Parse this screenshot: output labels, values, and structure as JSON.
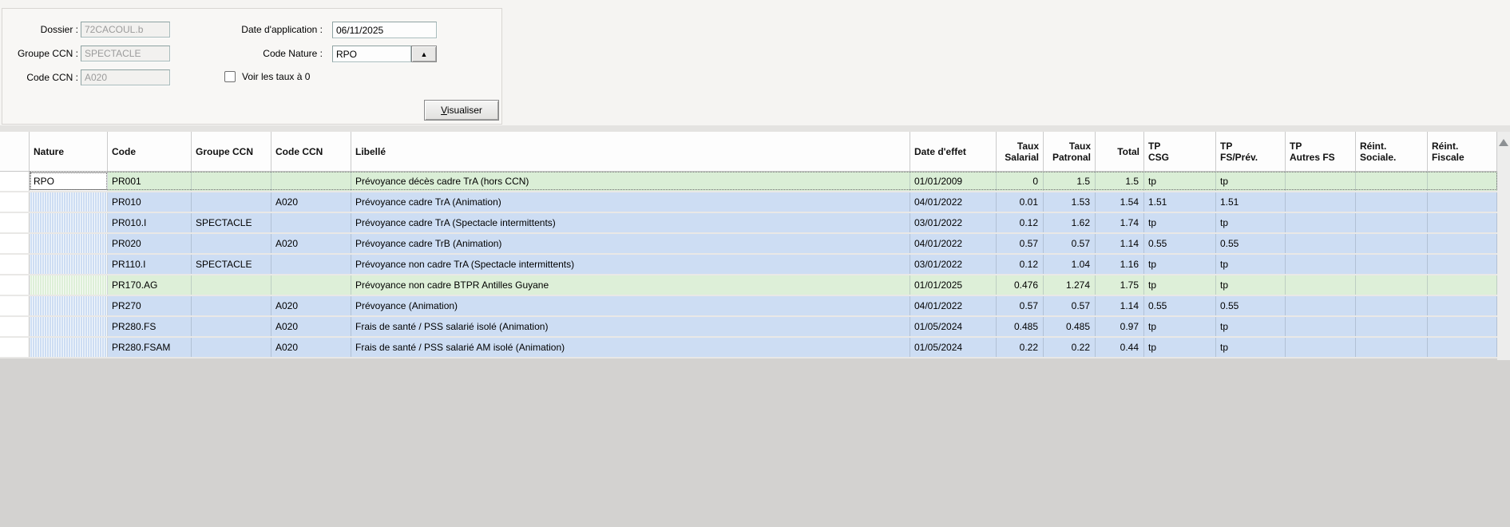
{
  "form": {
    "dossier": {
      "label": "Dossier :",
      "value": "72CACOUL.b"
    },
    "groupe_ccn": {
      "label": "Groupe CCN :",
      "value": "SPECTACLE"
    },
    "code_ccn": {
      "label": "Code CCN :",
      "value": "A020"
    },
    "date_application": {
      "label": "Date d'application :",
      "value": "06/11/2025"
    },
    "code_nature": {
      "label": "Code Nature :",
      "value": "RPO"
    },
    "voir_taux": {
      "label": "Voir les taux à 0",
      "checked": false
    },
    "visualiser_label": "Visualiser"
  },
  "table": {
    "columns": [
      {
        "key": "rowhead",
        "label": ""
      },
      {
        "key": "nature",
        "label": "Nature"
      },
      {
        "key": "code",
        "label": "Code"
      },
      {
        "key": "groupe_ccn",
        "label": "Groupe CCN"
      },
      {
        "key": "code_ccn",
        "label": "Code CCN"
      },
      {
        "key": "libelle",
        "label": "Libellé"
      },
      {
        "key": "date_effet",
        "label": "Date d'effet"
      },
      {
        "key": "taux_salarial",
        "label": "Taux\nSalarial"
      },
      {
        "key": "taux_patronal",
        "label": "Taux\nPatronal"
      },
      {
        "key": "total",
        "label": "Total"
      },
      {
        "key": "tp_csg",
        "label": "TP\nCSG"
      },
      {
        "key": "tp_fs_prev",
        "label": "TP\nFS/Prév."
      },
      {
        "key": "tp_autres_fs",
        "label": "TP\nAutres FS"
      },
      {
        "key": "reint_sociale",
        "label": "Réint.\nSociale."
      },
      {
        "key": "reint_fiscale",
        "label": "Réint.\nFiscale"
      }
    ],
    "rows": [
      {
        "nature": "RPO",
        "code": "PR001",
        "groupe_ccn": "",
        "code_ccn": "",
        "libelle": "Prévoyance décès cadre TrA (hors CCN)",
        "date_effet": "01/01/2009",
        "taux_salarial": "0",
        "taux_patronal": "1.5",
        "total": "1.5",
        "tp_csg": "tp",
        "tp_fs_prev": "tp",
        "tp_autres_fs": "",
        "reint_sociale": "",
        "reint_fiscale": "",
        "tone": "green",
        "selected": true,
        "nature_hatched": false
      },
      {
        "nature": "",
        "code": "PR010",
        "groupe_ccn": "",
        "code_ccn": "A020",
        "libelle": "Prévoyance cadre TrA (Animation)",
        "date_effet": "04/01/2022",
        "taux_salarial": "0.01",
        "taux_patronal": "1.53",
        "total": "1.54",
        "tp_csg": "1.51",
        "tp_fs_prev": "1.51",
        "tp_autres_fs": "",
        "reint_sociale": "",
        "reint_fiscale": "",
        "tone": "blue",
        "selected": false,
        "nature_hatched": true
      },
      {
        "nature": "",
        "code": "PR010.I",
        "groupe_ccn": "SPECTACLE",
        "code_ccn": "",
        "libelle": "Prévoyance cadre TrA (Spectacle intermittents)",
        "date_effet": "03/01/2022",
        "taux_salarial": "0.12",
        "taux_patronal": "1.62",
        "total": "1.74",
        "tp_csg": "tp",
        "tp_fs_prev": "tp",
        "tp_autres_fs": "",
        "reint_sociale": "",
        "reint_fiscale": "",
        "tone": "blue",
        "selected": false,
        "nature_hatched": true
      },
      {
        "nature": "",
        "code": "PR020",
        "groupe_ccn": "",
        "code_ccn": "A020",
        "libelle": "Prévoyance cadre TrB (Animation)",
        "date_effet": "04/01/2022",
        "taux_salarial": "0.57",
        "taux_patronal": "0.57",
        "total": "1.14",
        "tp_csg": "0.55",
        "tp_fs_prev": "0.55",
        "tp_autres_fs": "",
        "reint_sociale": "",
        "reint_fiscale": "",
        "tone": "blue",
        "selected": false,
        "nature_hatched": true
      },
      {
        "nature": "",
        "code": "PR110.I",
        "groupe_ccn": "SPECTACLE",
        "code_ccn": "",
        "libelle": "Prévoyance non cadre TrA (Spectacle intermittents)",
        "date_effet": "03/01/2022",
        "taux_salarial": "0.12",
        "taux_patronal": "1.04",
        "total": "1.16",
        "tp_csg": "tp",
        "tp_fs_prev": "tp",
        "tp_autres_fs": "",
        "reint_sociale": "",
        "reint_fiscale": "",
        "tone": "blue",
        "selected": false,
        "nature_hatched": true
      },
      {
        "nature": "",
        "code": "PR170.AG",
        "groupe_ccn": "",
        "code_ccn": "",
        "libelle": "Prévoyance non cadre BTPR Antilles Guyane",
        "date_effet": "01/01/2025",
        "taux_salarial": "0.476",
        "taux_patronal": "1.274",
        "total": "1.75",
        "tp_csg": "tp",
        "tp_fs_prev": "tp",
        "tp_autres_fs": "",
        "reint_sociale": "",
        "reint_fiscale": "",
        "tone": "green",
        "selected": false,
        "nature_hatched": true
      },
      {
        "nature": "",
        "code": "PR270",
        "groupe_ccn": "",
        "code_ccn": "A020",
        "libelle": "Prévoyance (Animation)",
        "date_effet": "04/01/2022",
        "taux_salarial": "0.57",
        "taux_patronal": "0.57",
        "total": "1.14",
        "tp_csg": "0.55",
        "tp_fs_prev": "0.55",
        "tp_autres_fs": "",
        "reint_sociale": "",
        "reint_fiscale": "",
        "tone": "blue",
        "selected": false,
        "nature_hatched": true
      },
      {
        "nature": "",
        "code": "PR280.FS",
        "groupe_ccn": "",
        "code_ccn": "A020",
        "libelle": "Frais de santé / PSS salarié isolé (Animation)",
        "date_effet": "01/05/2024",
        "taux_salarial": "0.485",
        "taux_patronal": "0.485",
        "total": "0.97",
        "tp_csg": "tp",
        "tp_fs_prev": "tp",
        "tp_autres_fs": "",
        "reint_sociale": "",
        "reint_fiscale": "",
        "tone": "blue",
        "selected": false,
        "nature_hatched": true
      },
      {
        "nature": "",
        "code": "PR280.FSAM",
        "groupe_ccn": "",
        "code_ccn": "A020",
        "libelle": "Frais de santé / PSS salarié AM isolé (Animation)",
        "date_effet": "01/05/2024",
        "taux_salarial": "0.22",
        "taux_patronal": "0.22",
        "total": "0.44",
        "tp_csg": "tp",
        "tp_fs_prev": "tp",
        "tp_autres_fs": "",
        "reint_sociale": "",
        "reint_fiscale": "",
        "tone": "blue",
        "selected": false,
        "nature_hatched": true
      }
    ]
  },
  "colors": {
    "row_blue": "#cdddf3",
    "row_green": "#daeed6",
    "row_green_alt": "#ddefd8",
    "header_bg": "#fdfdfd",
    "bottom_gray": "#d3d2d0",
    "selected_cell_bg": "#ffffff"
  }
}
